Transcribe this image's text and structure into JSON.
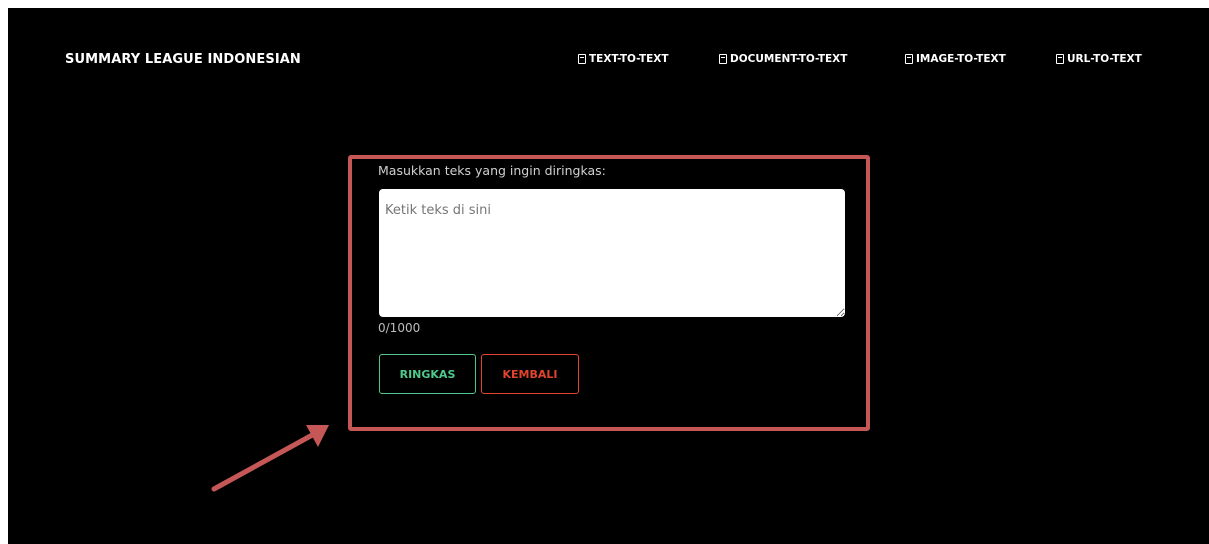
{
  "brand": {
    "title": "SUMMARY LEAGUE INDONESIAN"
  },
  "nav": {
    "items": [
      {
        "label": "TEXT-TO-TEXT",
        "icon": "doc-icon"
      },
      {
        "label": "DOCUMENT-TO-TEXT",
        "icon": "doc-icon"
      },
      {
        "label": "IMAGE-TO-TEXT",
        "icon": "doc-icon"
      },
      {
        "label": "URL-TO-TEXT",
        "icon": "doc-icon"
      }
    ]
  },
  "form": {
    "prompt_label": "Masukkan teks yang ingin diringkas:",
    "input_value": "",
    "input_placeholder": "Ketik teks di sini",
    "char_counter": "0/1000",
    "submit_label": "RINGKAS",
    "back_label": "KEMBALI"
  },
  "colors": {
    "background": "#000000",
    "highlight_border": "#c65757",
    "submit_accent": "#4ec98a",
    "back_accent": "#e1442c"
  }
}
